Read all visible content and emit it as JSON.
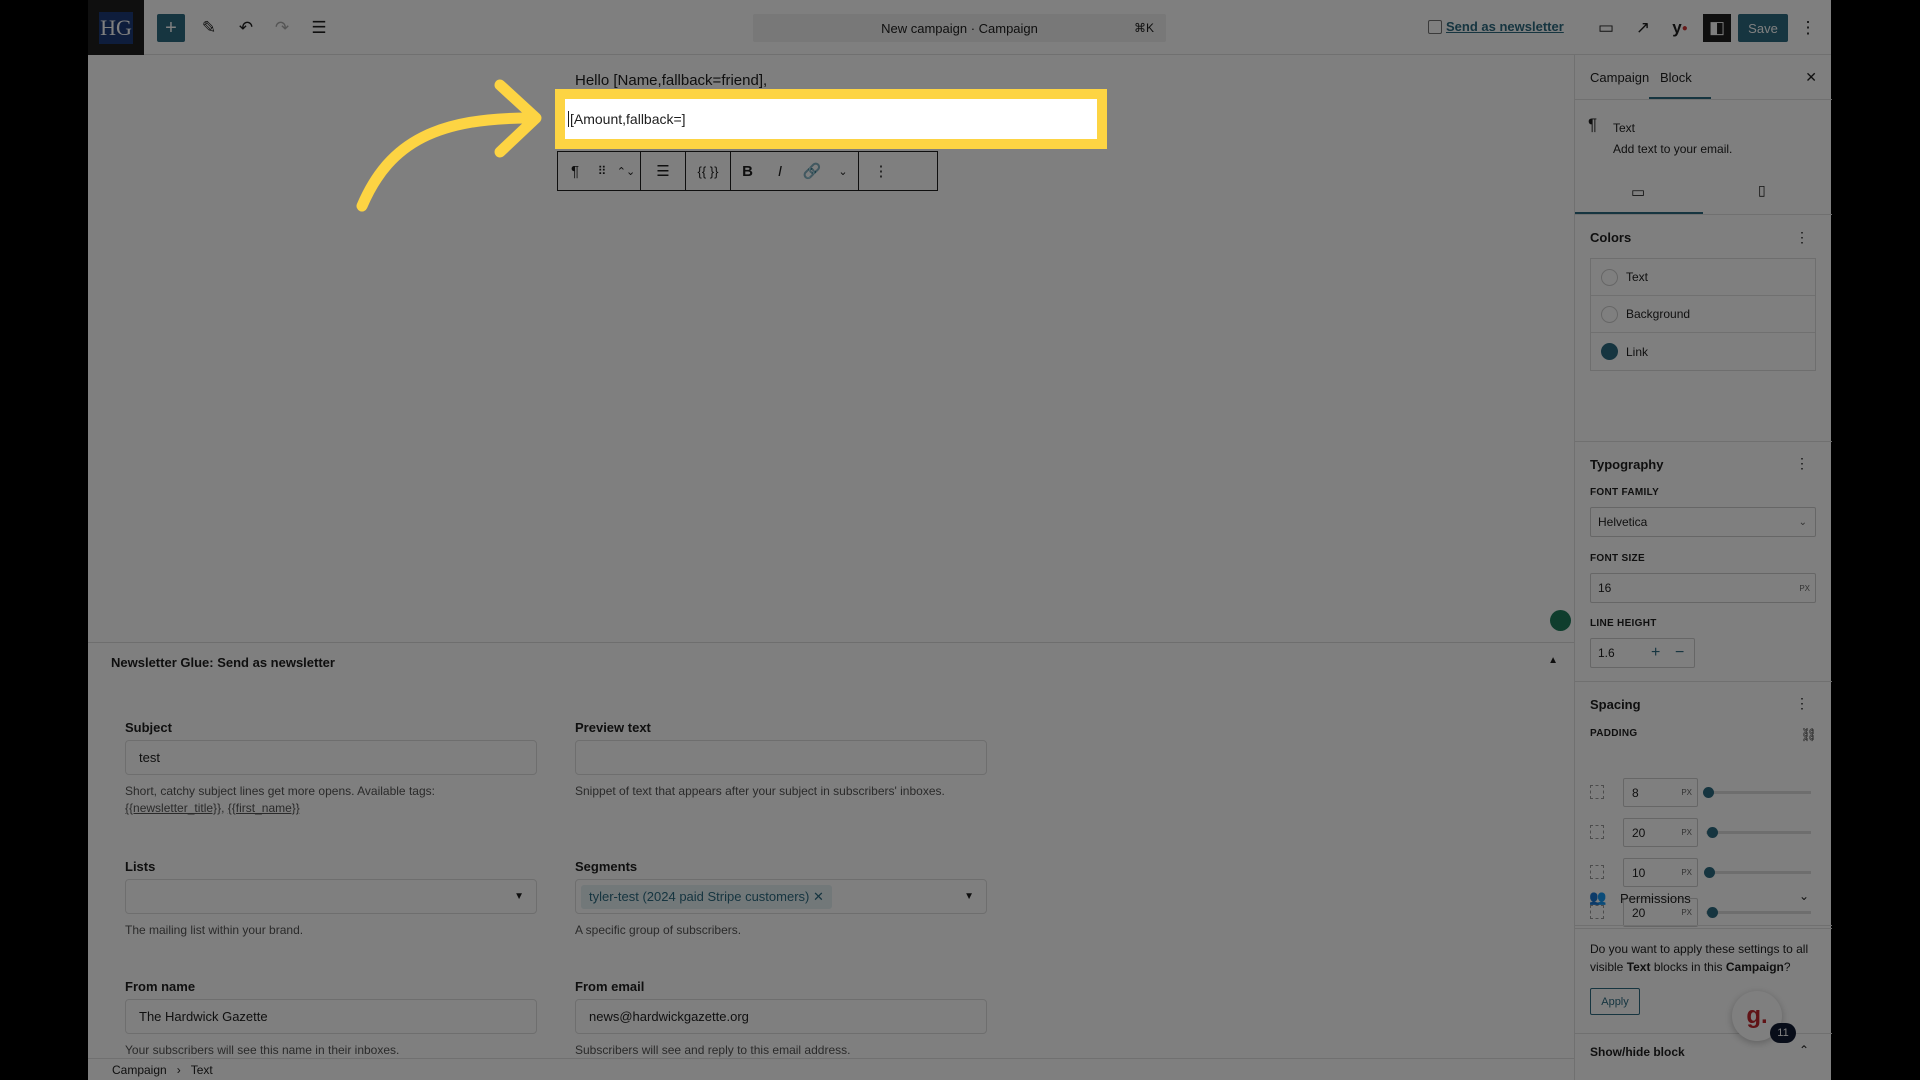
{
  "topbar": {
    "logo": "HG",
    "title": "New campaign · Campaign",
    "shortcut": "⌘K",
    "send_as_newsletter": "Send as newsletter",
    "save": "Save"
  },
  "editor": {
    "greeting": "Hello [Name,fallback=friend],",
    "selected_text": "[Amount,fallback=]"
  },
  "panel": {
    "title": "Newsletter Glue: Send as newsletter",
    "subject": {
      "label": "Subject",
      "value": "test",
      "help": "Short, catchy subject lines get more opens. Available tags:",
      "tag1": "{{newsletter_title}}",
      "tag2": "{{first_name}}"
    },
    "preview": {
      "label": "Preview text",
      "value": "",
      "help": "Snippet of text that appears after your subject in subscribers' inboxes."
    },
    "lists": {
      "label": "Lists",
      "value": "",
      "help": "The mailing list within your brand."
    },
    "segments": {
      "label": "Segments",
      "chip": "tyler-test (2024 paid Stripe customers)",
      "help": "A specific group of subscribers."
    },
    "from_name": {
      "label": "From name",
      "value": "The Hardwick Gazette",
      "help": "Your subscribers will see this name in their inboxes."
    },
    "from_email": {
      "label": "From email",
      "value": "news@hardwickgazette.org",
      "help": "Subscribers will see and reply to this email address."
    }
  },
  "breadcrumb": [
    "Campaign",
    "Text"
  ],
  "sidebar": {
    "tabs": [
      "Campaign",
      "Block"
    ],
    "active_tab": "Block",
    "block": {
      "name": "Text",
      "desc": "Add text to your email."
    },
    "colors": {
      "title": "Colors",
      "items": [
        "Text",
        "Background",
        "Link"
      ],
      "link_color": "#2c6a80"
    },
    "typography": {
      "title": "Typography",
      "font_family_label": "FONT FAMILY",
      "font_family": "Helvetica",
      "font_size_label": "FONT SIZE",
      "font_size": "16",
      "unit": "PX",
      "line_height_label": "LINE HEIGHT",
      "line_height": "1.6"
    },
    "spacing": {
      "title": "Spacing",
      "padding_label": "PADDING",
      "values": [
        "8",
        "20",
        "10",
        "20"
      ]
    },
    "permissions": "Permissions",
    "apply_text_1": "Do you want to apply these settings to all visible ",
    "apply_bold_1": "Text",
    "apply_text_2": " blocks in this ",
    "apply_bold_2": "Campaign",
    "apply_text_3": "?",
    "apply": "Apply",
    "show_hide": "Show/hide block"
  },
  "widget": {
    "badge": "11"
  },
  "accent": "#2c6a80",
  "highlight": "#fdd443"
}
